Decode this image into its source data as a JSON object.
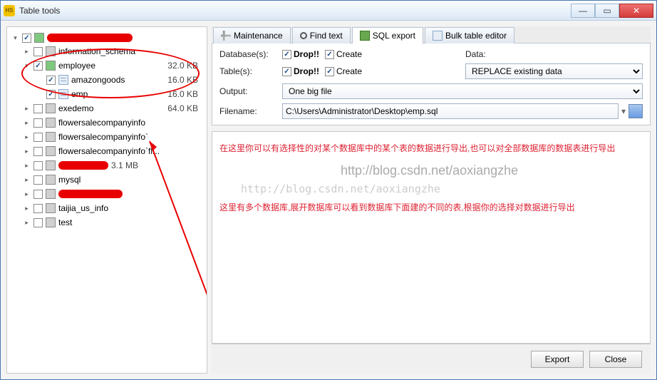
{
  "window": {
    "title": "Table tools"
  },
  "winbtn": {
    "min": "—",
    "max": "▭",
    "close": "✕"
  },
  "tree": {
    "root": {
      "expander": "▾"
    },
    "items": [
      {
        "exp": "▸",
        "checked": false,
        "label": "information_schema",
        "size": ""
      },
      {
        "exp": "▾",
        "checked": true,
        "label": "employee",
        "size": "32.0 KB",
        "green": true
      },
      {
        "exp": "",
        "checked": true,
        "label": "amazongoods",
        "size": "16.0 KB",
        "child": true
      },
      {
        "exp": "",
        "checked": true,
        "label": "emp",
        "size": "16.0 KB",
        "child": true
      },
      {
        "exp": "▸",
        "checked": false,
        "label": "exedemo",
        "size": "64.0 KB"
      },
      {
        "exp": "▸",
        "checked": false,
        "label": "flowersalecompanyinfo",
        "size": ""
      },
      {
        "exp": "▸",
        "checked": false,
        "label": "flowersalecompanyinfo`",
        "size": ""
      },
      {
        "exp": "▸",
        "checked": false,
        "label": "flowersalecompanyinfo`fl...",
        "size": ""
      },
      {
        "exp": "▸",
        "checked": false,
        "label": "",
        "size": "3.1 MB",
        "red": true,
        "redw": 70
      },
      {
        "exp": "▸",
        "checked": false,
        "label": "mysql",
        "size": ""
      },
      {
        "exp": "▸",
        "checked": false,
        "label": "",
        "size": "",
        "red": true,
        "redw": 90
      },
      {
        "exp": "▸",
        "checked": false,
        "label": "taijia_us_info",
        "size": ""
      },
      {
        "exp": "▸",
        "checked": false,
        "label": "test",
        "size": ""
      }
    ]
  },
  "tabs": [
    {
      "label": "Maintenance"
    },
    {
      "label": "Find text"
    },
    {
      "label": "SQL export"
    },
    {
      "label": "Bulk table editor"
    }
  ],
  "form": {
    "databases": "Database(s):",
    "tables": "Table(s):",
    "output": "Output:",
    "filename": "Filename:",
    "drop": "Drop!!",
    "create": "Create",
    "data": "Data:",
    "data_select": "REPLACE existing data",
    "output_select": "One big file",
    "filename_value": "C:\\Users\\Administrator\\Desktop\\emp.sql"
  },
  "notes": {
    "line1": "在这里你可以有选择性的对某个数据库中的某个表的数据进行导出,也可以对全部数据库的数据表进行导出",
    "line2": "这里有多个数据库,展开数据库可以看到数据库下面建的不同的表,根据你的选择对数据进行导出",
    "watermark": "http://blog.csdn.net/aoxiangzhe",
    "watermark2": "http://blog.csdn.net/aoxiangzhe"
  },
  "footer": {
    "export": "Export",
    "close": "Close"
  }
}
